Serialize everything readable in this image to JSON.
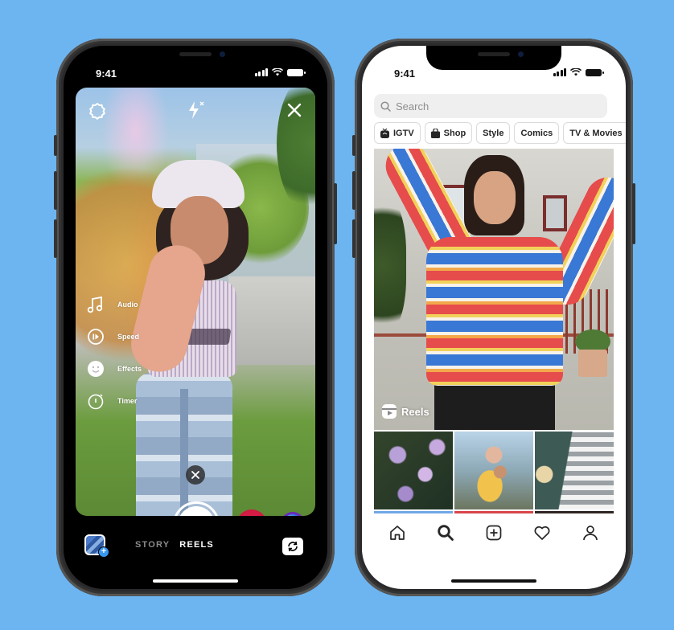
{
  "colors": {
    "background": "#6db5f0",
    "phone_frame": "#2a2a2c",
    "instagram_blue": "#3897f0",
    "effect_red": "#e3224e",
    "effect_purple": "#6a2dba"
  },
  "camera_phone": {
    "status_bar": {
      "time": "9:41",
      "icons": [
        "cellular-signal-icon",
        "wifi-icon",
        "battery-icon"
      ]
    },
    "top_controls": [
      "settings-icon",
      "flash-off-icon",
      "close-icon"
    ],
    "tools": [
      {
        "label": "Audio",
        "icon": "music-note-icon"
      },
      {
        "label": "Speed",
        "icon": "speed-icon"
      },
      {
        "label": "Effects",
        "icon": "effects-face-icon"
      },
      {
        "label": "Timer",
        "icon": "timer-icon"
      }
    ],
    "capture": {
      "discard_icon": "close-icon",
      "shutter_icon": "reels-logo-icon",
      "effects": [
        "glitter-effect",
        "blue-sphere-effect"
      ]
    },
    "mode_bar": {
      "gallery_icon": "gallery-add-icon",
      "modes": [
        "STORY",
        "REELS"
      ],
      "selected_mode": "REELS",
      "flip_icon": "flip-camera-icon"
    }
  },
  "explore_phone": {
    "status_bar": {
      "time": "9:41",
      "icons": [
        "cellular-signal-icon",
        "wifi-icon",
        "battery-icon"
      ]
    },
    "search": {
      "placeholder": "Search",
      "value": ""
    },
    "chips": [
      {
        "label": "IGTV",
        "icon": "igtv-icon"
      },
      {
        "label": "Shop",
        "icon": "shopping-bag-icon"
      },
      {
        "label": "Style"
      },
      {
        "label": "Comics"
      },
      {
        "label": "TV & Movies"
      }
    ],
    "featured": {
      "label": "Reels",
      "icon": "reels-icon"
    },
    "grid_tiles": [
      "flowers",
      "piggyback-hug",
      "skateboard",
      "raised-hand-sky",
      "red-sweater",
      "portrait"
    ],
    "tab_bar": [
      {
        "name": "home",
        "icon": "home-icon"
      },
      {
        "name": "search",
        "icon": "search-icon",
        "active": true
      },
      {
        "name": "new-post",
        "icon": "add-post-icon"
      },
      {
        "name": "activity",
        "icon": "heart-icon"
      },
      {
        "name": "profile",
        "icon": "profile-icon"
      }
    ]
  }
}
